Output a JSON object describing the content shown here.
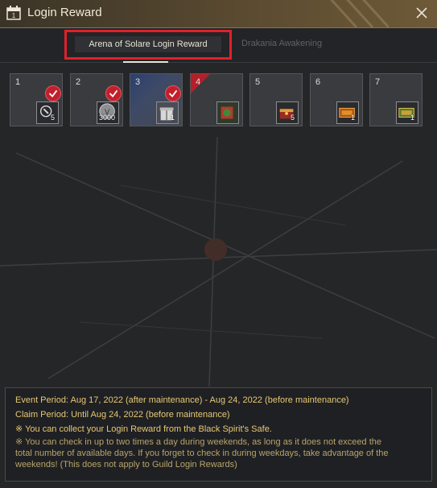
{
  "window": {
    "title": "Login Reward",
    "calendar_icon_day": "1"
  },
  "tabs": [
    {
      "label": "Arena of Solare Login Reward",
      "active": true
    },
    {
      "label": "Drakania Awakening",
      "active": false
    }
  ],
  "rewards": [
    {
      "day": "1",
      "count": "5",
      "claimed": true,
      "highlighted": false,
      "icon": "weapon-box-icon"
    },
    {
      "day": "2",
      "count": "3000",
      "claimed": true,
      "highlighted": false,
      "icon": "silver-coin-icon"
    },
    {
      "day": "3",
      "count": "1",
      "claimed": true,
      "highlighted": true,
      "icon": "gift-box-icon"
    },
    {
      "day": "4",
      "count": "",
      "claimed": false,
      "highlighted": false,
      "icon": "gift-crate-icon"
    },
    {
      "day": "5",
      "count": "5",
      "claimed": false,
      "highlighted": false,
      "icon": "treasure-chest-icon"
    },
    {
      "day": "6",
      "count": "1",
      "claimed": false,
      "highlighted": false,
      "icon": "coupon-icon"
    },
    {
      "day": "7",
      "count": "1",
      "claimed": false,
      "highlighted": false,
      "icon": "green-coupon-icon"
    }
  ],
  "info": {
    "event_period": "Event Period: Aug 17, 2022 (after maintenance) - Aug 24, 2022 (before maintenance)",
    "claim_period": "Claim Period: Until Aug 24, 2022 (before maintenance)",
    "note_safe": "※ You can collect your Login Reward from the Black Spirit's Safe.",
    "note_weekend_1": "※ You can check in up to two times a day during weekends, as long as it does not exceed the",
    "note_weekend_2": "total number of available days. If you forget to check in during weekdays, take advantage of the",
    "note_weekend_3": "weekends! (This does not apply to Guild Login Rewards)"
  },
  "colors": {
    "accent_red": "#e0202a",
    "claimed_check": "#c21f2c",
    "info_text": "#e6c874"
  }
}
